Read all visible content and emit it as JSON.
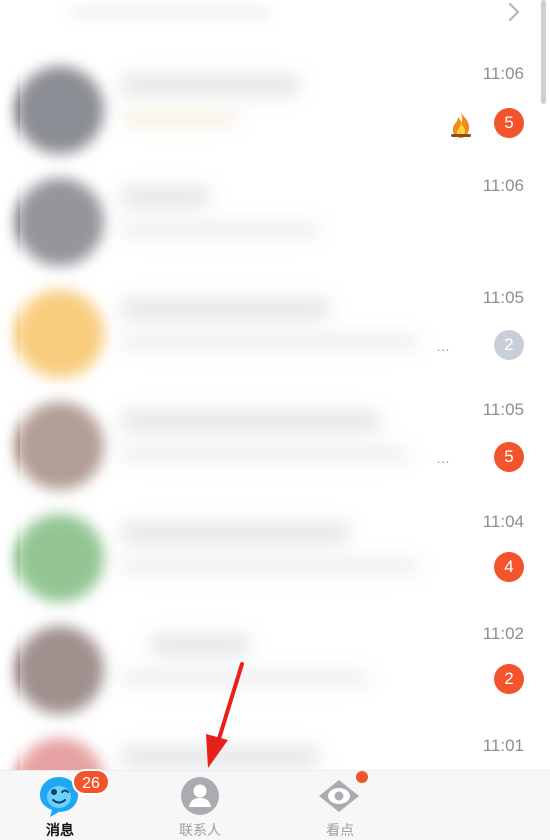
{
  "chat_list": {
    "rows": [
      {
        "time": "11:06",
        "badge": "5",
        "badge_style": "red",
        "has_fire_icon": true,
        "has_ellipsis": false,
        "avatar_color": "#4f525c"
      },
      {
        "time": "11:06",
        "badge": "",
        "badge_style": "none",
        "has_fire_icon": false,
        "has_ellipsis": false,
        "avatar_color": "#5b5e66"
      },
      {
        "time": "11:05",
        "badge": "2",
        "badge_style": "grey",
        "has_fire_icon": false,
        "has_ellipsis": true,
        "avatar_color": "#f5b23a"
      },
      {
        "time": "11:05",
        "badge": "5",
        "badge_style": "red",
        "has_fire_icon": false,
        "has_ellipsis": true,
        "avatar_color": "#8a6a5c"
      },
      {
        "time": "11:04",
        "badge": "4",
        "badge_style": "red",
        "has_fire_icon": false,
        "has_ellipsis": false,
        "avatar_color": "#5aa75a"
      },
      {
        "time": "11:02",
        "badge": "2",
        "badge_style": "red",
        "has_fire_icon": false,
        "has_ellipsis": false,
        "avatar_color": "#6d5652"
      },
      {
        "time": "11:01",
        "badge": "",
        "badge_style": "none",
        "has_fire_icon": false,
        "has_ellipsis": false,
        "avatar_color": "#d97070"
      }
    ],
    "ellipsis_text": "…"
  },
  "tab_bar": {
    "tabs": [
      {
        "label": "消息",
        "icon": "penguin-chat-icon",
        "active": true,
        "badge": "26"
      },
      {
        "label": "联系人",
        "icon": "contact-person-icon",
        "active": false,
        "badge": ""
      },
      {
        "label": "看点",
        "icon": "eye-icon",
        "active": false,
        "badge": ""
      }
    ]
  },
  "colors": {
    "badge_red": "#f2552c",
    "badge_grey": "#c9cfd8",
    "time_text": "#8e8e8e",
    "tab_active": "#111111",
    "tab_inactive": "#9aa0a6",
    "annotation_arrow": "#e8201c"
  }
}
